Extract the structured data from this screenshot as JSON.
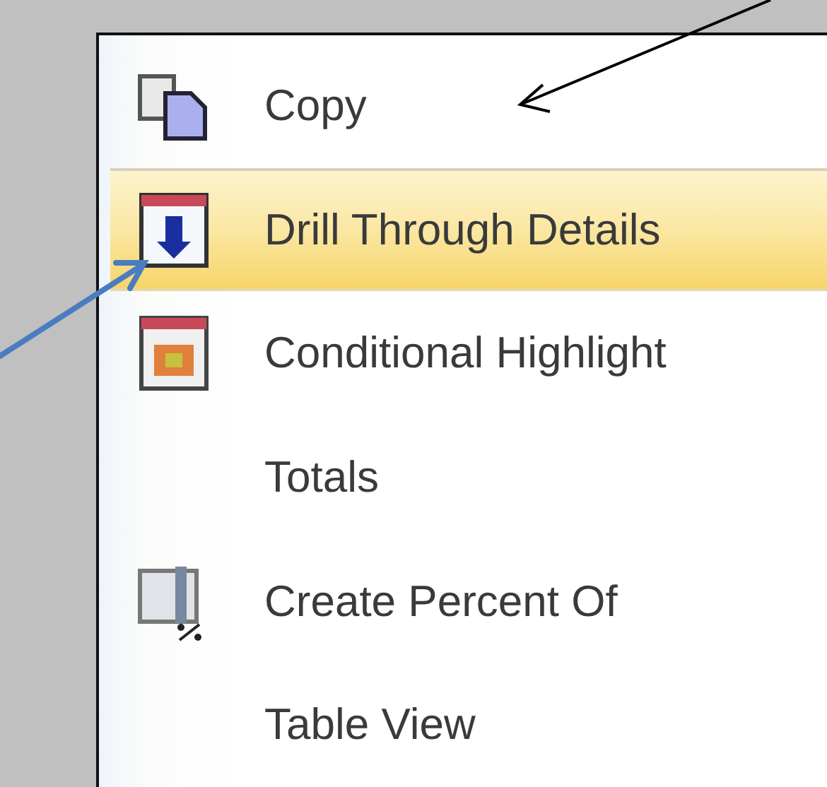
{
  "menu": {
    "items": [
      {
        "kind": "copy",
        "label": "Copy",
        "selected": false
      },
      {
        "kind": "drill",
        "label": "Drill Through Details",
        "selected": true
      },
      {
        "kind": "highlight",
        "label": "Conditional Highlight",
        "selected": false
      },
      {
        "kind": "plain",
        "label": "Totals",
        "selected": false
      },
      {
        "kind": "percent",
        "label": "Create Percent Of",
        "selected": false
      },
      {
        "kind": "plain",
        "label": "Table View",
        "selected": false
      }
    ]
  }
}
